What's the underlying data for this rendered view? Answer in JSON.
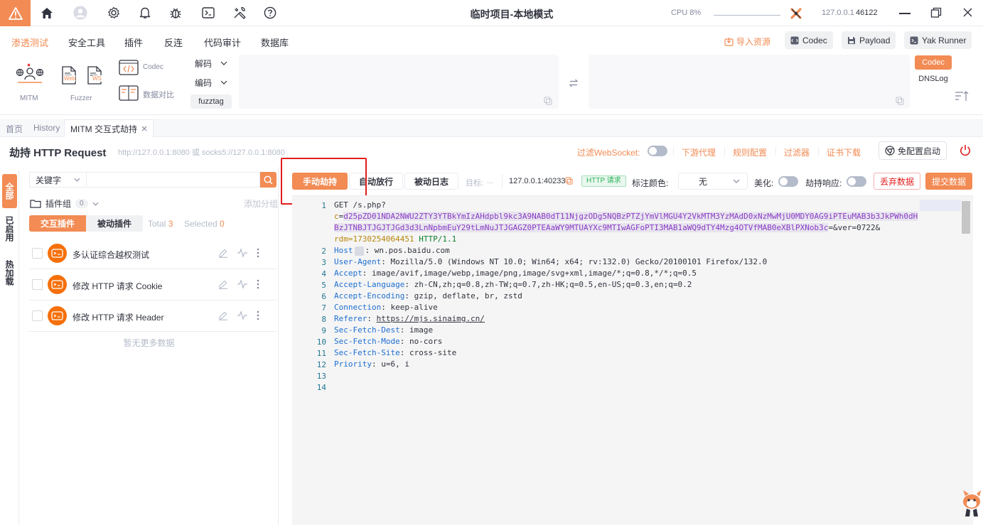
{
  "titlebar": {
    "title": "临时项目-本地模式",
    "cpu": "CPU 8%",
    "host_ip": "127.0.0.1",
    "host_port": "46122"
  },
  "menu": {
    "items": [
      "渗透测试",
      "安全工具",
      "插件",
      "反连",
      "代码审计",
      "数据库"
    ],
    "active": "渗透测试",
    "import": "导入资源",
    "right_buttons": [
      "Codec",
      "Payload",
      "Yak Runner"
    ]
  },
  "toolbar": {
    "mitm": "MITM",
    "fuzzer": "Fuzzer",
    "web": "Web",
    "ws": "WS",
    "codec": "Codec",
    "compare": "数据对比",
    "decode": "解码",
    "encode": "编码",
    "fuzztag": "fuzztag",
    "side_tabs": [
      "Codec",
      "DNSLog"
    ]
  },
  "tabs": {
    "home": "首页",
    "history": "History",
    "mitm": "MITM 交互式劫持"
  },
  "header": {
    "title": "劫持 HTTP Request",
    "proxy": "http://127.0.0.1:8080 或 socks5://127.0.0.1:8080",
    "filter_ws": "过滤WebSocket:",
    "downstream": "下游代理",
    "rules": "规则配置",
    "filters": "过滤器",
    "cert": "证书下载",
    "no_config": "免配置启动"
  },
  "left_tabs": [
    "全部",
    "已启用",
    "热加载"
  ],
  "plugins": {
    "keyword": "关键字",
    "group": "插件组",
    "group_count": "0",
    "add_group": "添加分组",
    "tab_interactive": "交互插件",
    "tab_passive": "被动插件",
    "total_label": "Total",
    "total": "3",
    "selected_label": "Selected",
    "selected": "0",
    "items": [
      "多认证综合越权测试",
      "修改 HTTP 请求 Cookie",
      "修改 HTTP 请求 Header"
    ],
    "no_more": "暂无更多数据"
  },
  "controls": {
    "manual": "手动劫持",
    "auto": "自动放行",
    "passive_log": "被动日志",
    "target_label": "目标:",
    "target_dots": "...",
    "address": "127.0.0.1:40233",
    "badge": "HTTP 请求",
    "color_label": "标注颜色:",
    "color_value": "无",
    "beautify": "美化:",
    "hijack_resp": "劫持响应:",
    "discard": "丢弃数据",
    "submit": "提交数据"
  },
  "request": {
    "line1_method": "GET /s.php?",
    "c_key": "c",
    "c_val_1": "d25pZD01NDA2NWU2ZTY3YTBkYmIzAHdpbl9kc3A9NAB0dT11NjgzODg5NQBzPTZjYmVlMGU4Y2VkMTM3YzMAdD0xNzMwMjU0MDY0AG9iPTEuMAB3b3JkPWh0dH",
    "c_val_2": "BzJTNBJTJGJTJGd3d3LnNpbmEuY29tLmNuJTJGAGZ0PTEAaWY9MTUAYXc9MTIwAGFoPTI3MAB1aWQ9dTY4Mzg4OTVfMAB0eXBlPXNob3c",
    "ver_part": "=&ver=0722&",
    "rdm": "rdm=1730254064451",
    "proto": " HTTP/1.1",
    "headers": [
      {
        "k": "Host",
        "v": "wn.pos.baidu.com"
      },
      {
        "k": "User-Agent",
        "v": "Mozilla/5.0 (Windows NT 10.0; Win64; x64; rv:132.0) Gecko/20100101 Firefox/132.0"
      },
      {
        "k": "Accept",
        "v": "image/avif,image/webp,image/png,image/svg+xml,image/*;q=0.8,*/*;q=0.5"
      },
      {
        "k": "Accept-Language",
        "v": "zh-CN,zh;q=0.8,zh-TW;q=0.7,zh-HK;q=0.5,en-US;q=0.3,en;q=0.2"
      },
      {
        "k": "Accept-Encoding",
        "v": "gzip, deflate, br, zstd"
      },
      {
        "k": "Connection",
        "v": "keep-alive"
      },
      {
        "k": "Referer",
        "v": "https://mjs.sinaimg.cn/"
      },
      {
        "k": "Sec-Fetch-Dest",
        "v": "image"
      },
      {
        "k": "Sec-Fetch-Mode",
        "v": "no-cors"
      },
      {
        "k": "Sec-Fetch-Site",
        "v": "cross-site"
      },
      {
        "k": "Priority",
        "v": "u=6, i"
      }
    ],
    "line_numbers": [
      "1",
      "2",
      "3",
      "4",
      "5",
      "6",
      "7",
      "8",
      "9",
      "10",
      "11",
      "12",
      "13",
      "14"
    ]
  },
  "colors": {
    "accent": "#f28b54",
    "text": "#31343f",
    "muted": "#85899e",
    "border": "#eaecf3"
  }
}
